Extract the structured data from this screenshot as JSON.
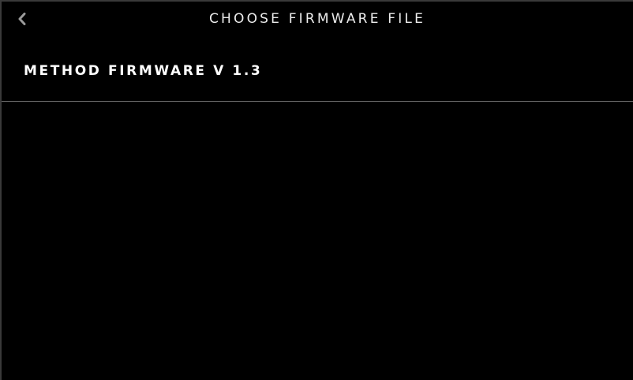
{
  "header": {
    "title": "CHOOSE FIRMWARE FILE",
    "back_icon": "chevron-left-icon"
  },
  "files": [
    {
      "label": "METHOD FIRMWARE V 1.3"
    }
  ],
  "colors": {
    "background": "#000000",
    "text": "#ffffff",
    "divider": "#6e6e6e",
    "icon": "#9a9a9a"
  }
}
